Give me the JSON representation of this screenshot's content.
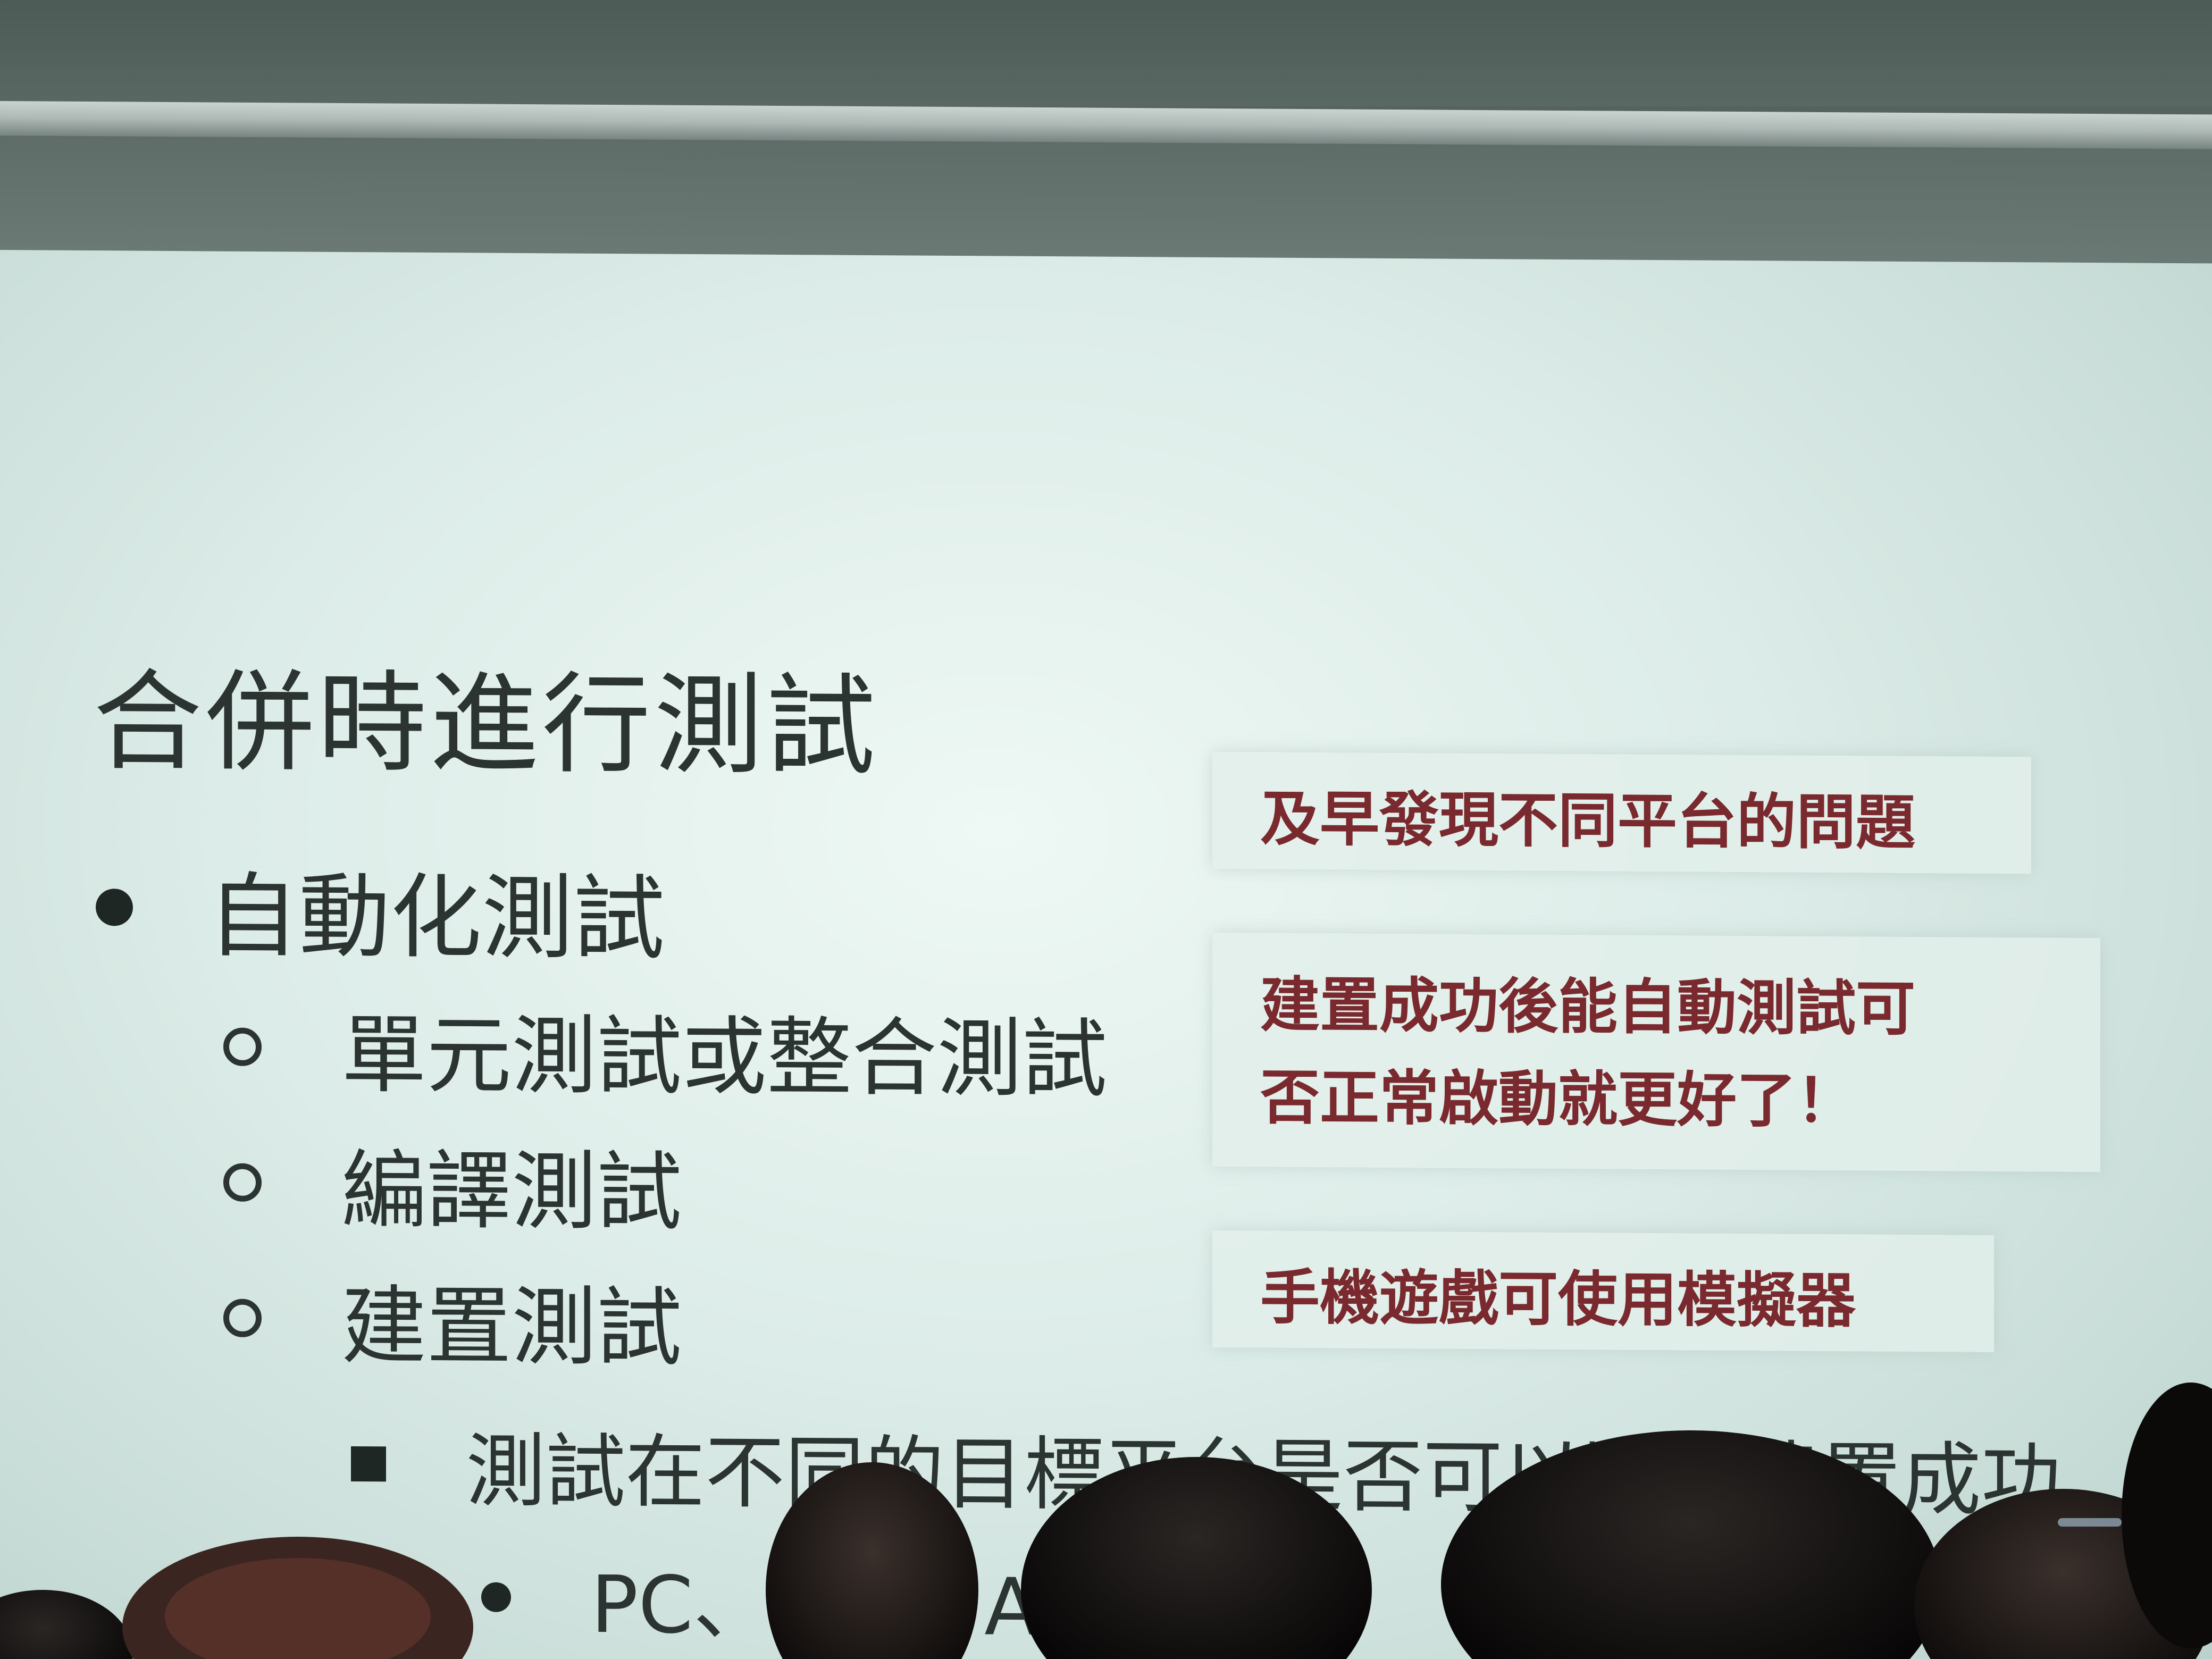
{
  "slide": {
    "title": "合併時進行測試",
    "bullets": {
      "level1": "自動化測試",
      "level2": [
        "單元測試或整合測試",
        "編譯測試",
        "建置測試"
      ],
      "level3": "測試在不同的目標平台是否可以順利建置成功",
      "level4": "PC、iOS、Android"
    },
    "notes": {
      "note1": "及早發現不同平台的問題",
      "note2_line1": "建置成功後能自動測試可",
      "note2_line2": "否正常啟動就更好了！",
      "note3": "手機遊戲可使用模擬器"
    }
  },
  "colors": {
    "slide_background": "#dcece8",
    "body_text": "#2b3431",
    "note_text": "#7a2a2e"
  }
}
